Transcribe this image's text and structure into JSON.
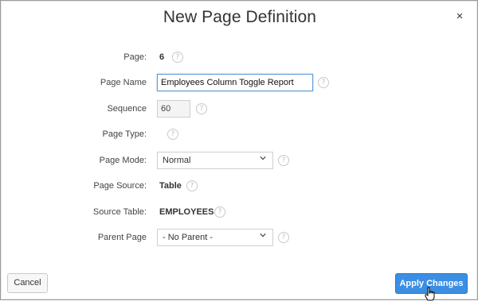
{
  "dialog": {
    "title": "New Page Definition",
    "close_symbol": "×"
  },
  "fields": {
    "page": {
      "label": "Page:",
      "value": "6"
    },
    "page_name": {
      "label": "Page Name",
      "value": "Employees Column Toggle Report"
    },
    "sequence": {
      "label": "Sequence",
      "value": "60"
    },
    "page_type": {
      "label": "Page Type:"
    },
    "page_mode": {
      "label": "Page Mode:",
      "selected": "Normal"
    },
    "page_source": {
      "label": "Page Source:",
      "value": "Table"
    },
    "source_table": {
      "label": "Source Table:",
      "value": "EMPLOYEES"
    },
    "parent_page": {
      "label": "Parent Page",
      "selected": "- No Parent -"
    }
  },
  "help_symbol": "?",
  "buttons": {
    "cancel": "Cancel",
    "apply": "Apply Changes"
  },
  "colors": {
    "primary": "#3b8ee3",
    "focus_border": "#5b9bd5"
  }
}
